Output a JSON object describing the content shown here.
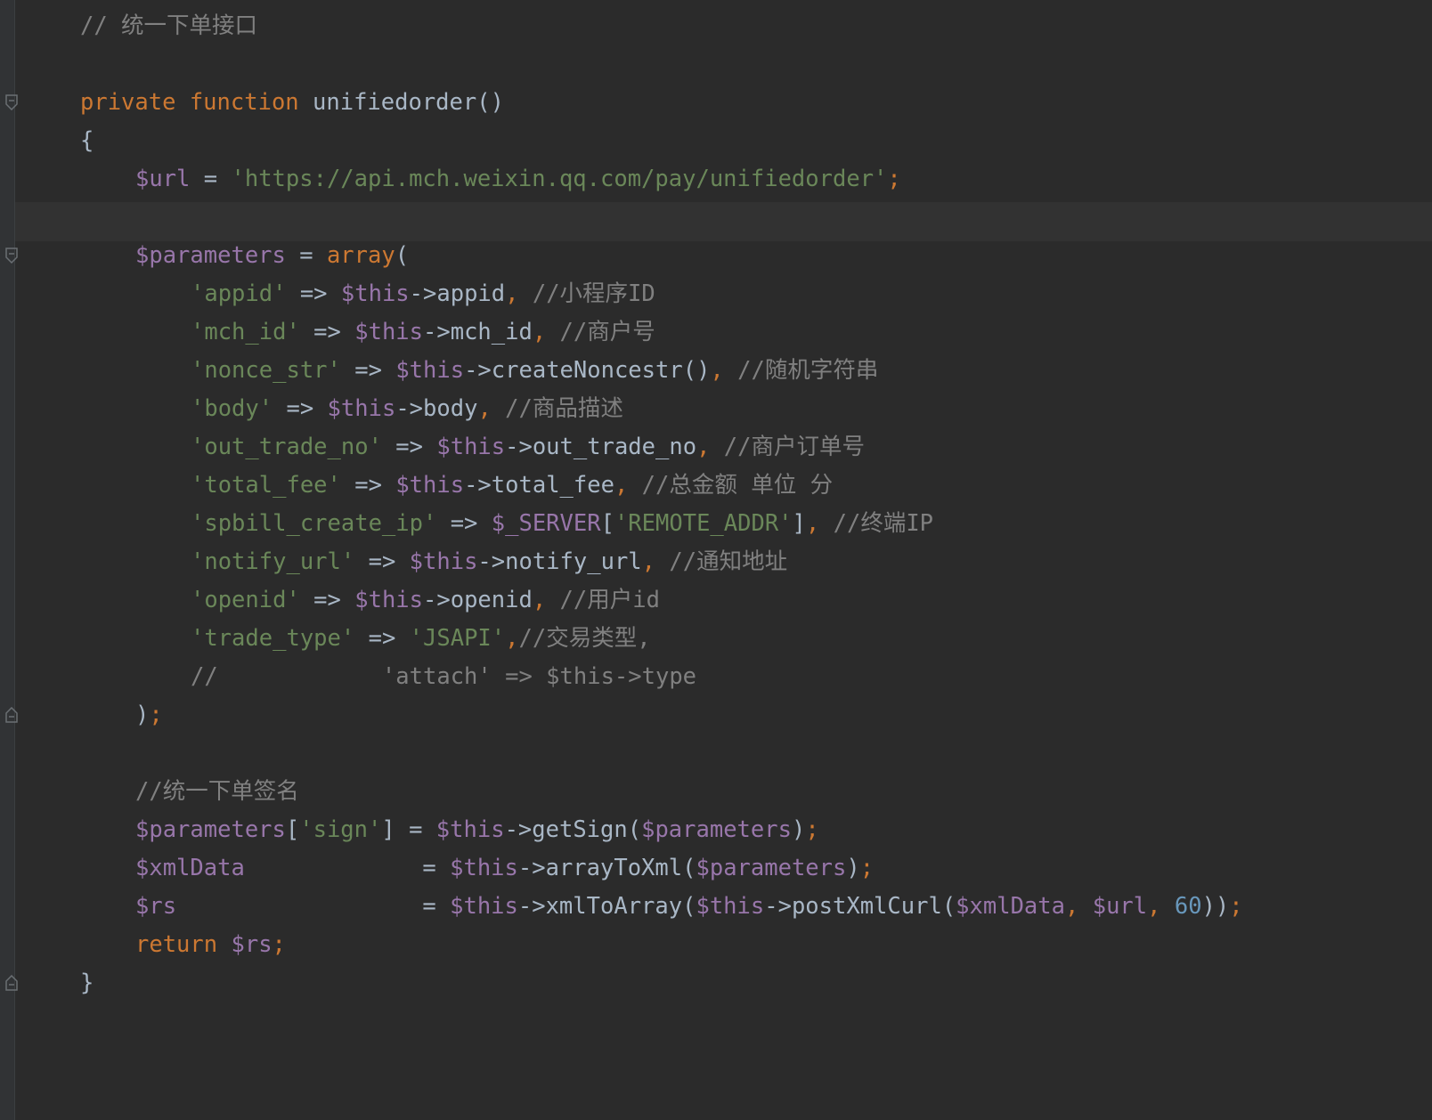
{
  "editor": {
    "lines": [
      {
        "indent": 0,
        "tokens": [
          {
            "t": "// 统一下单接口",
            "c": "cmt"
          }
        ]
      },
      {
        "indent": 0,
        "tokens": []
      },
      {
        "indent": 0,
        "tokens": [
          {
            "t": "private",
            "c": "kw"
          },
          {
            "t": " ",
            "c": "plain"
          },
          {
            "t": "function",
            "c": "kw"
          },
          {
            "t": " unifiedorder()",
            "c": "plain"
          }
        ]
      },
      {
        "indent": 0,
        "tokens": [
          {
            "t": "{",
            "c": "plain"
          }
        ]
      },
      {
        "indent": 1,
        "tokens": [
          {
            "t": "$url",
            "c": "var"
          },
          {
            "t": " = ",
            "c": "plain"
          },
          {
            "t": "'https://api.mch.weixin.qq.com/pay/unifiedorder'",
            "c": "str"
          },
          {
            "t": ";",
            "c": "punc"
          }
        ]
      },
      {
        "indent": 0,
        "tokens": []
      },
      {
        "indent": 1,
        "tokens": [
          {
            "t": "$parameters",
            "c": "var"
          },
          {
            "t": " = ",
            "c": "plain"
          },
          {
            "t": "array",
            "c": "kw"
          },
          {
            "t": "(",
            "c": "plain"
          }
        ]
      },
      {
        "indent": 2,
        "tokens": [
          {
            "t": "'appid'",
            "c": "str"
          },
          {
            "t": " => ",
            "c": "plain"
          },
          {
            "t": "$this",
            "c": "var"
          },
          {
            "t": "->appid",
            "c": "plain"
          },
          {
            "t": ",",
            "c": "punc"
          },
          {
            "t": " //小程序ID",
            "c": "cmt"
          }
        ]
      },
      {
        "indent": 2,
        "tokens": [
          {
            "t": "'mch_id'",
            "c": "str"
          },
          {
            "t": " => ",
            "c": "plain"
          },
          {
            "t": "$this",
            "c": "var"
          },
          {
            "t": "->mch_id",
            "c": "plain"
          },
          {
            "t": ",",
            "c": "punc"
          },
          {
            "t": " //商户号",
            "c": "cmt"
          }
        ]
      },
      {
        "indent": 2,
        "tokens": [
          {
            "t": "'nonce_str'",
            "c": "str"
          },
          {
            "t": " => ",
            "c": "plain"
          },
          {
            "t": "$this",
            "c": "var"
          },
          {
            "t": "->createNoncestr()",
            "c": "plain"
          },
          {
            "t": ",",
            "c": "punc"
          },
          {
            "t": " //随机字符串",
            "c": "cmt"
          }
        ]
      },
      {
        "indent": 2,
        "tokens": [
          {
            "t": "'body'",
            "c": "str"
          },
          {
            "t": " => ",
            "c": "plain"
          },
          {
            "t": "$this",
            "c": "var"
          },
          {
            "t": "->body",
            "c": "plain"
          },
          {
            "t": ",",
            "c": "punc"
          },
          {
            "t": " //商品描述",
            "c": "cmt"
          }
        ]
      },
      {
        "indent": 2,
        "tokens": [
          {
            "t": "'out_trade_no'",
            "c": "str"
          },
          {
            "t": " => ",
            "c": "plain"
          },
          {
            "t": "$this",
            "c": "var"
          },
          {
            "t": "->out_trade_no",
            "c": "plain"
          },
          {
            "t": ",",
            "c": "punc"
          },
          {
            "t": " //商户订单号",
            "c": "cmt"
          }
        ]
      },
      {
        "indent": 2,
        "tokens": [
          {
            "t": "'total_fee'",
            "c": "str"
          },
          {
            "t": " => ",
            "c": "plain"
          },
          {
            "t": "$this",
            "c": "var"
          },
          {
            "t": "->total_fee",
            "c": "plain"
          },
          {
            "t": ",",
            "c": "punc"
          },
          {
            "t": " //总金额 单位 分",
            "c": "cmt"
          }
        ]
      },
      {
        "indent": 2,
        "tokens": [
          {
            "t": "'spbill_create_ip'",
            "c": "str"
          },
          {
            "t": " => ",
            "c": "plain"
          },
          {
            "t": "$_SERVER",
            "c": "var"
          },
          {
            "t": "[",
            "c": "plain"
          },
          {
            "t": "'REMOTE_ADDR'",
            "c": "str"
          },
          {
            "t": "]",
            "c": "plain"
          },
          {
            "t": ",",
            "c": "punc"
          },
          {
            "t": " //终端IP",
            "c": "cmt"
          }
        ]
      },
      {
        "indent": 2,
        "tokens": [
          {
            "t": "'notify_url'",
            "c": "str"
          },
          {
            "t": " => ",
            "c": "plain"
          },
          {
            "t": "$this",
            "c": "var"
          },
          {
            "t": "->notify_url",
            "c": "plain"
          },
          {
            "t": ",",
            "c": "punc"
          },
          {
            "t": " //通知地址",
            "c": "cmt"
          }
        ]
      },
      {
        "indent": 2,
        "tokens": [
          {
            "t": "'openid'",
            "c": "str"
          },
          {
            "t": " => ",
            "c": "plain"
          },
          {
            "t": "$this",
            "c": "var"
          },
          {
            "t": "->openid",
            "c": "plain"
          },
          {
            "t": ",",
            "c": "punc"
          },
          {
            "t": " //用户id",
            "c": "cmt"
          }
        ]
      },
      {
        "indent": 2,
        "tokens": [
          {
            "t": "'trade_type'",
            "c": "str"
          },
          {
            "t": " => ",
            "c": "plain"
          },
          {
            "t": "'JSAPI'",
            "c": "str"
          },
          {
            "t": ",",
            "c": "punc"
          },
          {
            "t": "//交易类型,",
            "c": "cmt"
          }
        ]
      },
      {
        "indent": 2,
        "tokens": [
          {
            "t": "//            'attach' => $this->type",
            "c": "cmt"
          }
        ]
      },
      {
        "indent": 1,
        "tokens": [
          {
            "t": ")",
            "c": "plain"
          },
          {
            "t": ";",
            "c": "punc"
          }
        ]
      },
      {
        "indent": 0,
        "tokens": []
      },
      {
        "indent": 1,
        "tokens": [
          {
            "t": "//统一下单签名",
            "c": "cmt"
          }
        ]
      },
      {
        "indent": 1,
        "tokens": [
          {
            "t": "$parameters",
            "c": "var"
          },
          {
            "t": "[",
            "c": "plain"
          },
          {
            "t": "'sign'",
            "c": "str"
          },
          {
            "t": "] = ",
            "c": "plain"
          },
          {
            "t": "$this",
            "c": "var"
          },
          {
            "t": "->getSign(",
            "c": "plain"
          },
          {
            "t": "$parameters",
            "c": "var"
          },
          {
            "t": ")",
            "c": "plain"
          },
          {
            "t": ";",
            "c": "punc"
          }
        ]
      },
      {
        "indent": 1,
        "tokens": [
          {
            "t": "$xmlData",
            "c": "var"
          },
          {
            "t": "             = ",
            "c": "plain"
          },
          {
            "t": "$this",
            "c": "var"
          },
          {
            "t": "->arrayToXml(",
            "c": "plain"
          },
          {
            "t": "$parameters",
            "c": "var"
          },
          {
            "t": ")",
            "c": "plain"
          },
          {
            "t": ";",
            "c": "punc"
          }
        ]
      },
      {
        "indent": 1,
        "tokens": [
          {
            "t": "$rs",
            "c": "var"
          },
          {
            "t": "                  = ",
            "c": "plain"
          },
          {
            "t": "$this",
            "c": "var"
          },
          {
            "t": "->xmlToArray(",
            "c": "plain"
          },
          {
            "t": "$this",
            "c": "var"
          },
          {
            "t": "->postXmlCurl(",
            "c": "plain"
          },
          {
            "t": "$xmlData",
            "c": "var"
          },
          {
            "t": ", ",
            "c": "punc"
          },
          {
            "t": "$url",
            "c": "var"
          },
          {
            "t": ", ",
            "c": "punc"
          },
          {
            "t": "60",
            "c": "num"
          },
          {
            "t": "))",
            "c": "plain"
          },
          {
            "t": ";",
            "c": "punc"
          }
        ]
      },
      {
        "indent": 1,
        "tokens": [
          {
            "t": "return",
            "c": "kw"
          },
          {
            "t": " ",
            "c": "plain"
          },
          {
            "t": "$rs",
            "c": "var"
          },
          {
            "t": ";",
            "c": "punc"
          }
        ]
      },
      {
        "indent": 0,
        "tokens": [
          {
            "t": "}",
            "c": "plain"
          }
        ]
      }
    ],
    "colors": {
      "background": "#2b2b2b",
      "keyword": "#cc7832",
      "variable": "#9876aa",
      "string": "#6a8759",
      "comment": "#808080",
      "number": "#6897bb",
      "text": "#a9b7c6"
    },
    "fold_markers": [
      {
        "line": 2,
        "icon": "fold-open-icon"
      },
      {
        "line": 6,
        "icon": "fold-open-icon"
      },
      {
        "line": 18,
        "icon": "fold-close-icon"
      },
      {
        "line": 25,
        "icon": "fold-close-icon"
      }
    ]
  }
}
